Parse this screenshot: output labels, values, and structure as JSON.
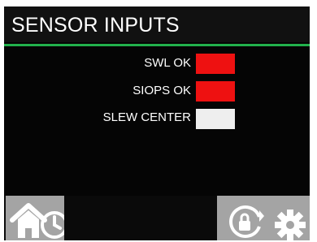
{
  "header": {
    "title": "SENSOR INPUTS"
  },
  "sensors": [
    {
      "label": "SWL OK",
      "state_color": "#ee1111"
    },
    {
      "label": "SIOPS OK",
      "state_color": "#ee1111"
    },
    {
      "label": "SLEW CENTER",
      "state_color": "#eeeeee"
    }
  ],
  "colors": {
    "accent_rule": "#22b14c",
    "button_gray": "#a4a4a4"
  },
  "footer": {
    "buttons": [
      {
        "icon": "home-icon"
      },
      {
        "icon": "clock-icon"
      },
      {
        "icon": "lock-icon"
      },
      {
        "icon": "gear-icon"
      }
    ]
  }
}
